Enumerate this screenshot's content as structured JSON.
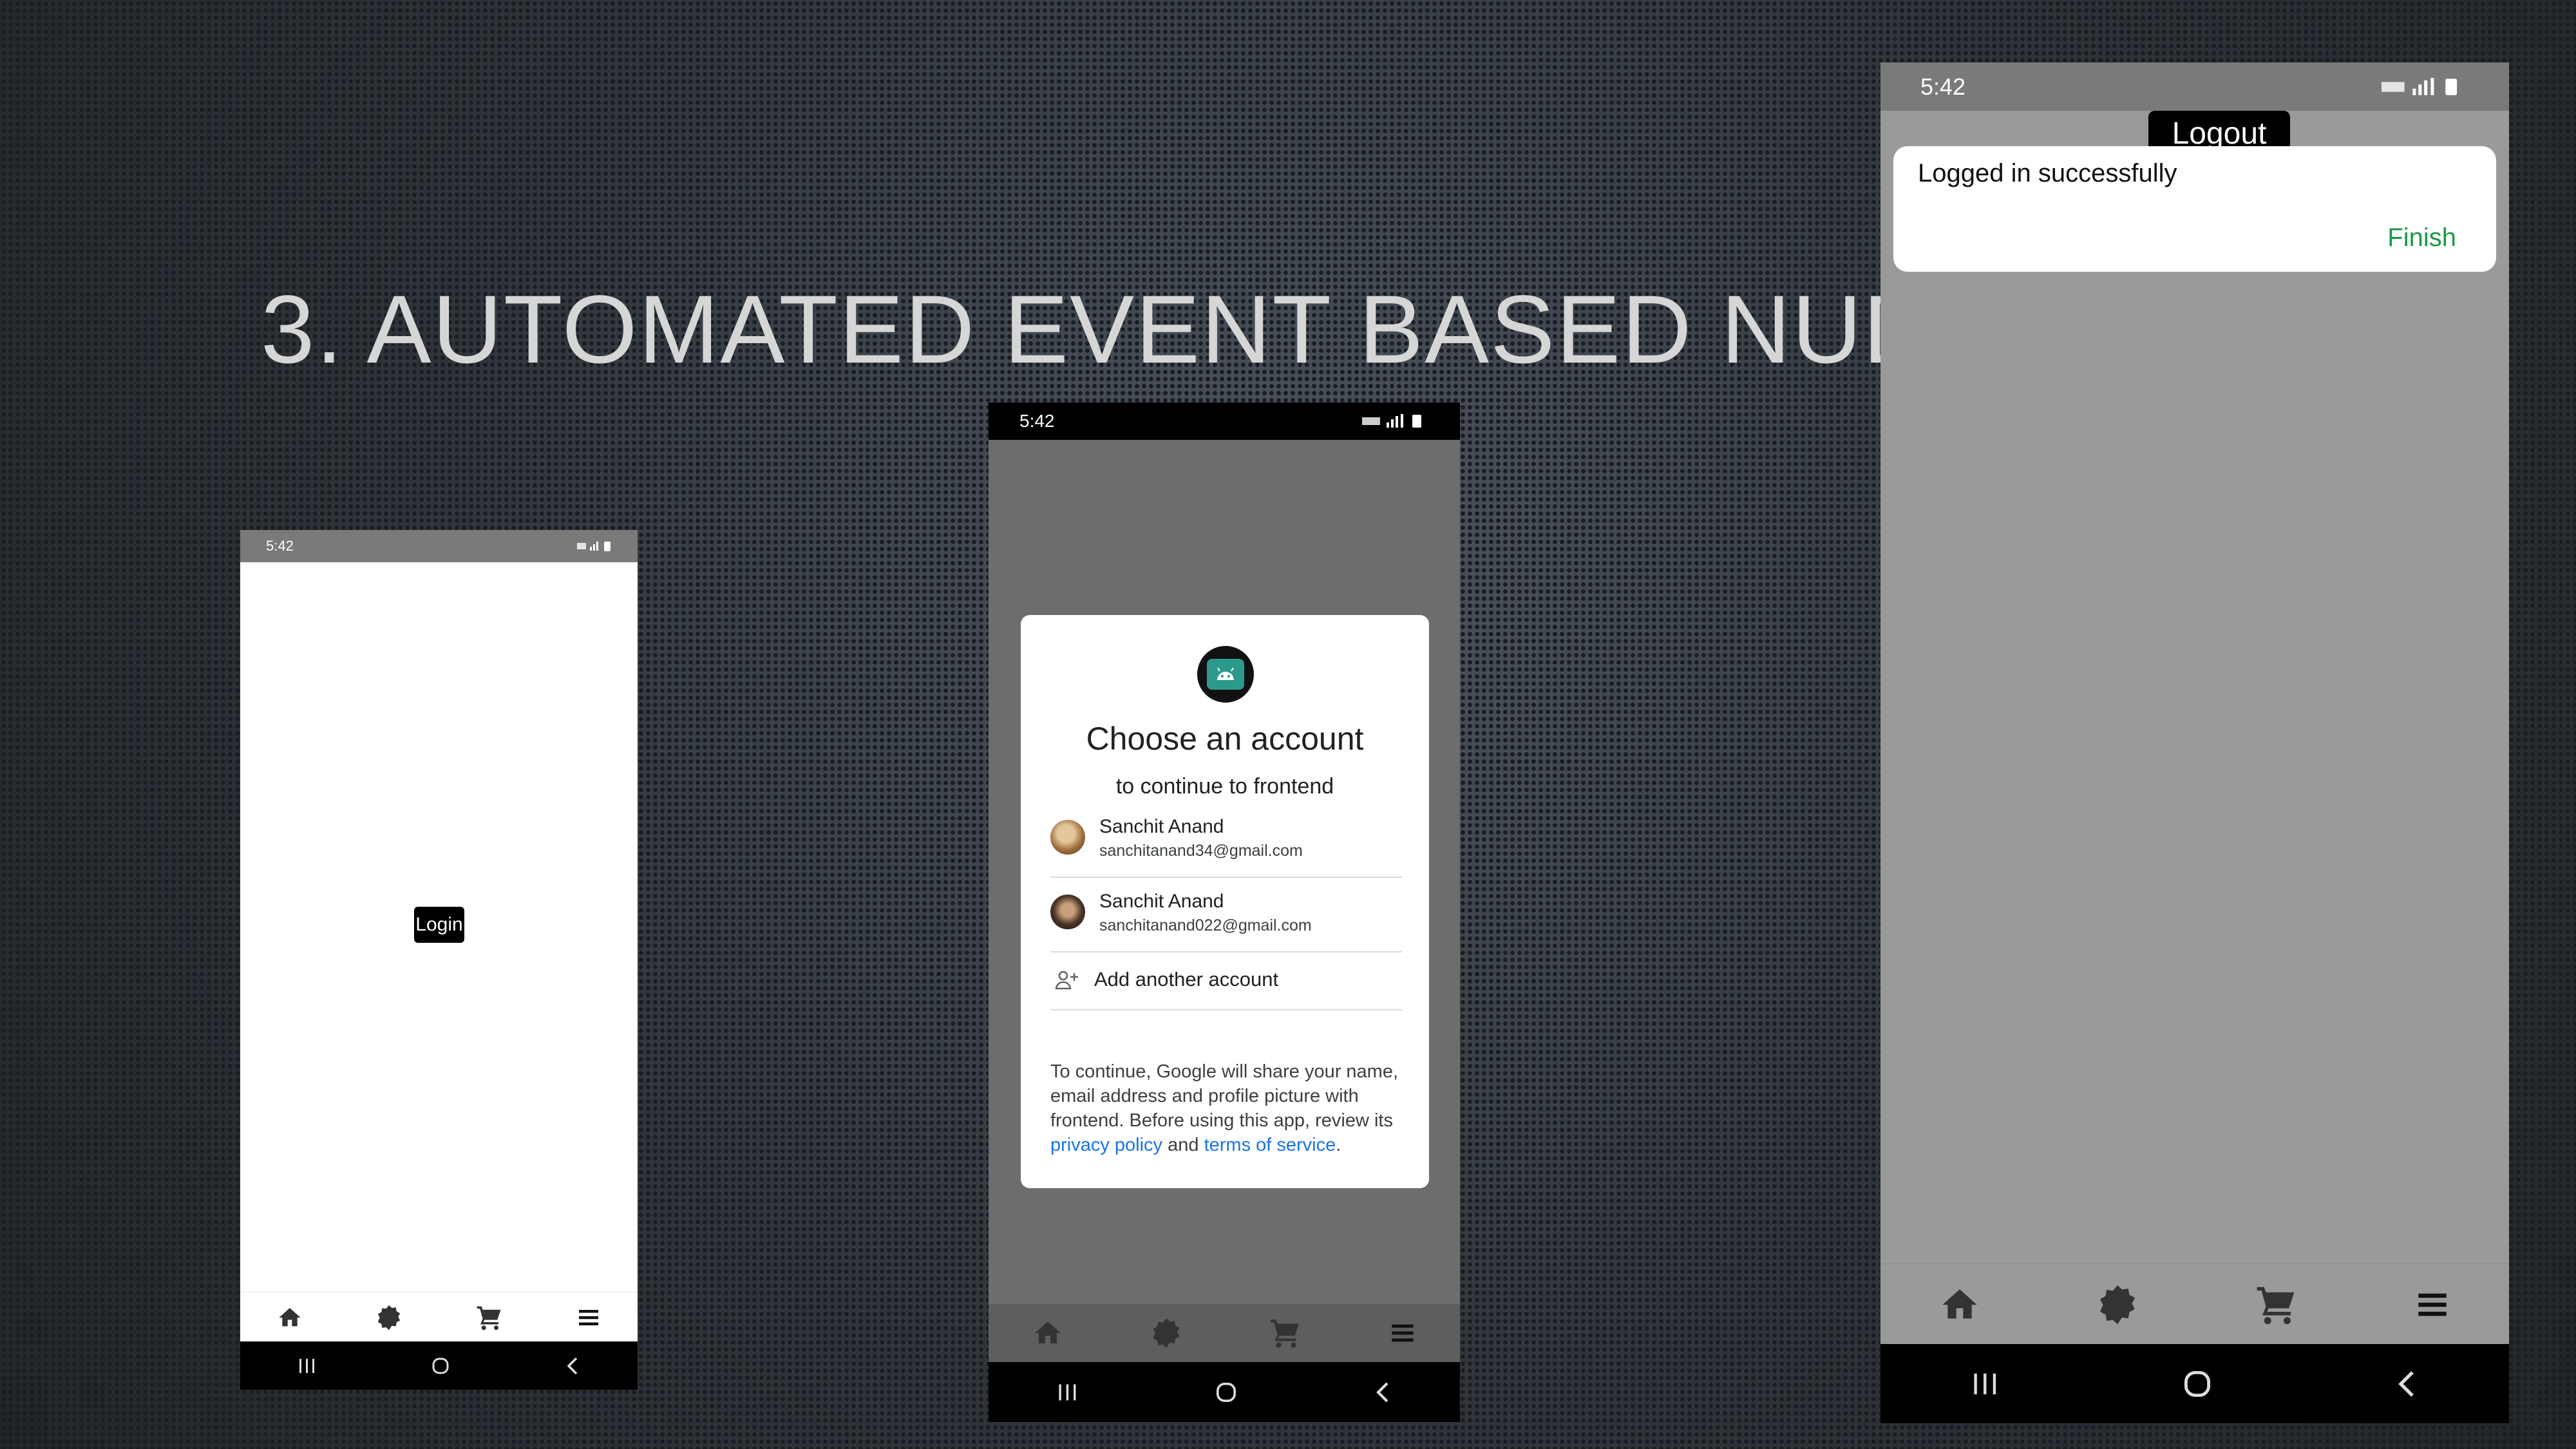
{
  "slide": {
    "title": "3. AUTOMATED EVENT BASED NUDGE:"
  },
  "status_bar": {
    "time": "5:42"
  },
  "phone_login": {
    "login_label": "Login"
  },
  "account_chooser": {
    "title": "Choose an account",
    "subtitle": "to continue to frontend",
    "accounts": [
      {
        "name": "Sanchit Anand",
        "email": "sanchitanand34@gmail.com"
      },
      {
        "name": "Sanchit Anand",
        "email": "sanchitanand022@gmail.com"
      }
    ],
    "add_account": "Add another account",
    "disclaimer_text": "To continue, Google will share your name, email address and profile picture with frontend. Before using this app, review its ",
    "privacy_policy": "privacy policy",
    "and": " and ",
    "terms": "terms of service",
    "period": "."
  },
  "phone_success": {
    "logout_label": "Logout",
    "toast_message": "Logged in successfully",
    "finish_label": "Finish"
  },
  "icons": {
    "bottom_nav": [
      "home-icon",
      "badge-icon",
      "cart-icon",
      "menu-icon"
    ],
    "system_nav": [
      "recent-apps-icon",
      "home-circle-icon",
      "back-icon"
    ]
  },
  "colors": {
    "link": "#1a73e8",
    "finish": "#1a9a48"
  }
}
